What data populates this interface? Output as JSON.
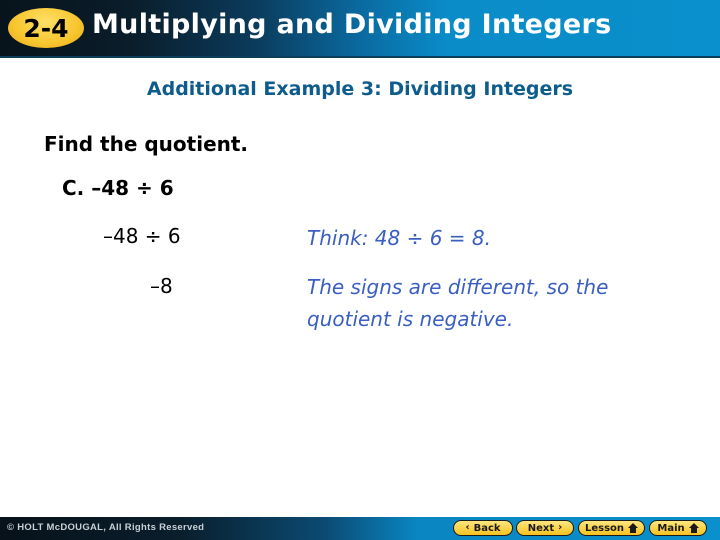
{
  "header": {
    "lesson_badge": "2-4",
    "title": "Multiplying and Dividing Integers"
  },
  "slide": {
    "subtitle": "Additional Example 3: Dividing Integers",
    "prompt": "Find the quotient.",
    "problem": "C. –48 ÷ 6",
    "steps": [
      {
        "expression": "–48 ÷ 6",
        "note": "Think: 48 ÷ 6 = 8."
      },
      {
        "expression": "–8",
        "note": "The signs are different, so the quotient is negative."
      }
    ]
  },
  "footer": {
    "copyright": "© HOLT McDOUGAL, All Rights Reserved",
    "nav": {
      "back_label": "Back",
      "next_label": "Next",
      "lesson_label": "Lesson",
      "main_label": "Main"
    }
  },
  "colors": {
    "subtitle": "#0e5c8c",
    "note": "#3a5fc0",
    "badge": "#f7c52e",
    "header_blue": "#0a90cc"
  }
}
